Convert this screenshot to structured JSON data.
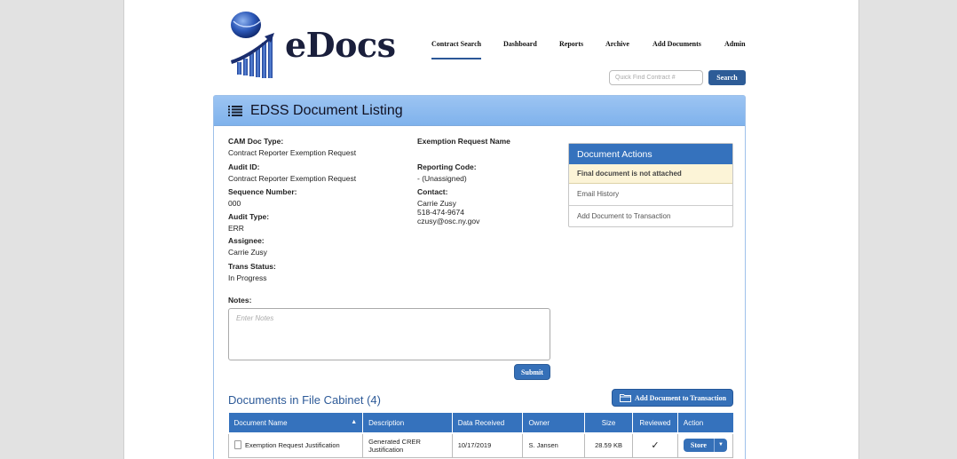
{
  "header": {
    "logo_text": "eDocs",
    "nav": [
      {
        "label": "Contract Search",
        "active": true
      },
      {
        "label": "Dashboard"
      },
      {
        "label": "Reports"
      },
      {
        "label": "Archive"
      },
      {
        "label": "Add Documents"
      },
      {
        "label": "Admin"
      }
    ],
    "quick_find_placeholder": "Quick Find Contract #",
    "search_label": "Search"
  },
  "panel": {
    "title": "EDSS Document Listing",
    "fields": {
      "cam_doc_type": {
        "label": "CAM Doc Type:",
        "value": "Contract Reporter Exemption Request"
      },
      "audit_id": {
        "label": "Audit ID:",
        "value": "Contract Reporter Exemption Request"
      },
      "sequence_number": {
        "label": "Sequence Number:",
        "value": "000"
      },
      "audit_type": {
        "label": "Audit Type:",
        "value": "ERR"
      },
      "assignee": {
        "label": "Assignee:",
        "value": "Carrie Zusy"
      },
      "trans_status": {
        "label": "Trans Status:",
        "value": "In Progress"
      },
      "exemption_request_name": {
        "label": "Exemption Request Name"
      },
      "reporting_code": {
        "label": "Reporting Code:",
        "value": "- (Unassigned)"
      },
      "contact": {
        "label": "Contact:",
        "name": "Carrie Zusy",
        "phone": "518-474-9674",
        "email": "czusy@osc.ny.gov"
      }
    },
    "notes_label": "Notes:",
    "notes_placeholder": "Enter Notes",
    "submit_label": "Submit"
  },
  "document_actions": {
    "title": "Document Actions",
    "alert": "Final document is not attached",
    "items": [
      "Email History",
      "Add Document to Transaction"
    ]
  },
  "documents": {
    "title": "Documents in File Cabinet (4)",
    "add_button": "Add Document to Transaction",
    "columns": [
      "Document Name",
      "Description",
      "Data Received",
      "Owner",
      "Size",
      "Reviewed",
      "Action"
    ],
    "rows": [
      {
        "name": "Exemption Request Justification",
        "description_line1": "Generated CRER",
        "description_line2": "Justification",
        "date_received": "10/17/2019",
        "owner": "S. Jansen",
        "size": "28.59 KB",
        "reviewed": "✓",
        "action": "Store"
      }
    ]
  },
  "colors": {
    "brand_blue": "#3572bd",
    "header_gradient": "#9cc4f2",
    "alert_bg": "#fcf4d7"
  }
}
